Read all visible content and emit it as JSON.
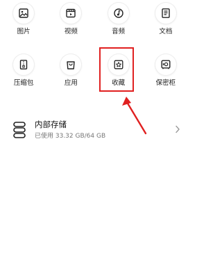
{
  "categories_row1": [
    {
      "label": "图片",
      "icon": "image-icon"
    },
    {
      "label": "视频",
      "icon": "video-icon"
    },
    {
      "label": "音频",
      "icon": "music-icon"
    },
    {
      "label": "文档",
      "icon": "document-icon"
    }
  ],
  "categories_row2": [
    {
      "label": "压缩包",
      "icon": "archive-icon"
    },
    {
      "label": "应用",
      "icon": "app-bag-icon"
    },
    {
      "label": "收藏",
      "icon": "favorites-star-icon"
    },
    {
      "label": "保密柜",
      "icon": "safe-icon"
    }
  ],
  "storage": {
    "title": "内部存储",
    "usage": "已使用 33.32 GB/64 GB",
    "icon": "storage-icon"
  },
  "annotation": {
    "highlight_color": "#e02020",
    "target": "收藏"
  }
}
